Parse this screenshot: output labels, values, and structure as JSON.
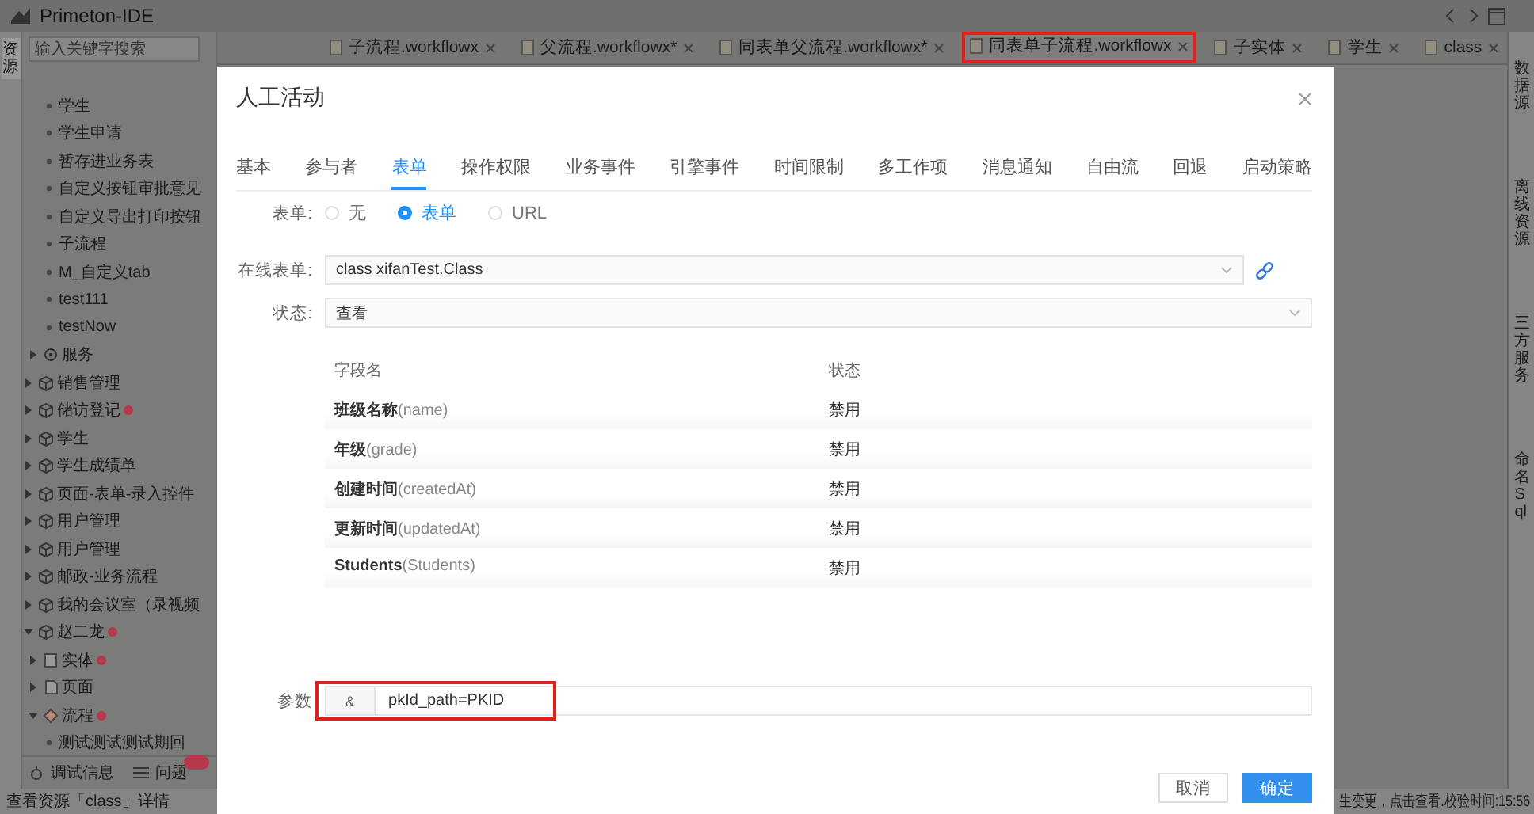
{
  "window": {
    "title": "Primeton-IDE"
  },
  "left_strip": {
    "label": "资源"
  },
  "sidebar": {
    "search": {
      "placeholder": "输入关键字搜索"
    },
    "tree": [
      {
        "kind": "offscreen",
        "children": [
          {
            "kind": "offscreen",
            "children": [
              {
                "label": "学生",
                "kind": "leaf"
              },
              {
                "label": "学生申请",
                "kind": "leaf"
              },
              {
                "label": "暂存进业务表",
                "kind": "leaf"
              },
              {
                "label": "自定义按钮审批意见",
                "kind": "leaf"
              },
              {
                "label": "自定义导出打印按钮",
                "kind": "leaf"
              },
              {
                "label": "子流程",
                "kind": "leaf"
              },
              {
                "label": "M_自定义tab",
                "kind": "leaf"
              },
              {
                "label": "test111",
                "kind": "leaf"
              },
              {
                "label": "testNow",
                "kind": "leaf"
              }
            ]
          },
          {
            "label": "服务",
            "kind": "service",
            "expanded": false,
            "alert": false
          }
        ]
      },
      {
        "label": "销售管理",
        "kind": "project",
        "expanded": false,
        "alert": false
      },
      {
        "label": "储访登记",
        "kind": "project",
        "expanded": false,
        "alert": true
      },
      {
        "label": "学生",
        "kind": "project",
        "expanded": false,
        "alert": false
      },
      {
        "label": "学生成绩单",
        "kind": "project",
        "expanded": false,
        "alert": false
      },
      {
        "label": "页面-表单-录入控件",
        "kind": "project",
        "expanded": false,
        "alert": false
      },
      {
        "label": "用户管理",
        "kind": "project",
        "expanded": false,
        "alert": false
      },
      {
        "label": "用户管理",
        "kind": "project",
        "expanded": false,
        "alert": false
      },
      {
        "label": "邮政-业务流程",
        "kind": "project",
        "expanded": false,
        "alert": false
      },
      {
        "label": "我的会议室（录视频",
        "kind": "project",
        "expanded": false,
        "alert": false
      },
      {
        "label": "赵二龙",
        "kind": "project",
        "expanded": true,
        "alert": true,
        "children": [
          {
            "label": "实体",
            "kind": "entity",
            "expanded": false,
            "alert": true
          },
          {
            "label": "页面",
            "kind": "pages",
            "expanded": false,
            "alert": false
          },
          {
            "label": "流程",
            "kind": "flow",
            "expanded": true,
            "alert": true,
            "children": [
              {
                "label": "测试测试测试期回",
                "kind": "leaf"
              }
            ]
          }
        ]
      }
    ],
    "panels": [
      {
        "label": "调试信息",
        "kind": "debug",
        "alert": false
      },
      {
        "label": "问题",
        "kind": "problems",
        "alert": true
      }
    ]
  },
  "editor_tabs": [
    {
      "label": "子流程.workflowx",
      "selected": false,
      "highlighted": false
    },
    {
      "label": "父流程.workflowx*",
      "selected": false,
      "highlighted": false
    },
    {
      "label": "同表单父流程.workflowx*",
      "selected": false,
      "highlighted": false
    },
    {
      "label": "同表单子流程.workflowx",
      "selected": true,
      "highlighted": true
    },
    {
      "label": "子实体",
      "selected": false,
      "highlighted": false
    },
    {
      "label": "学生",
      "selected": false,
      "highlighted": false
    },
    {
      "label": "class",
      "selected": false,
      "highlighted": false
    }
  ],
  "right_strip": [
    {
      "label": "数据源"
    },
    {
      "label": "离线资源"
    },
    {
      "label": "三方服务"
    },
    {
      "label": "命名Sql"
    }
  ],
  "dialog": {
    "title": "人工活动",
    "tabs": [
      {
        "label": "基本",
        "selected": false
      },
      {
        "label": "参与者",
        "selected": false
      },
      {
        "label": "表单",
        "selected": true
      },
      {
        "label": "操作权限",
        "selected": false
      },
      {
        "label": "业务事件",
        "selected": false
      },
      {
        "label": "引擎事件",
        "selected": false
      },
      {
        "label": "时间限制",
        "selected": false
      },
      {
        "label": "多工作项",
        "selected": false
      },
      {
        "label": "消息通知",
        "selected": false
      },
      {
        "label": "自由流",
        "selected": false
      },
      {
        "label": "回退",
        "selected": false
      },
      {
        "label": "启动策略",
        "selected": false
      }
    ],
    "form_type": {
      "label": "表单:",
      "options": [
        {
          "label": "无",
          "selected": false
        },
        {
          "label": "表单",
          "selected": true
        },
        {
          "label": "URL",
          "selected": false
        }
      ]
    },
    "online_form": {
      "label": "在线表单:",
      "value": "class xifanTest.Class"
    },
    "status": {
      "label": "状态:",
      "value": "查看"
    },
    "fields": {
      "columns": [
        "字段名",
        "状态"
      ],
      "rows": [
        {
          "name": "**班级名称**(name)",
          "status": "禁用"
        },
        {
          "name": "**年级**(grade)",
          "status": "禁用"
        },
        {
          "name": "**创建时间**(createdAt)",
          "status": "禁用"
        },
        {
          "name": "**更新时间**(updatedAt)",
          "status": "禁用"
        },
        {
          "name": "**Students**(Students)",
          "status": "禁用"
        }
      ]
    },
    "params": {
      "label": "参数",
      "prefix": "&",
      "value": "pkId_path=PKID",
      "highlighted": true
    },
    "buttons": [
      {
        "label": "取消",
        "kind": "default"
      },
      {
        "label": "确定",
        "kind": "primary"
      }
    ]
  },
  "status_bar": {
    "left": "查看资源「class」详情",
    "right": "生变更，点击查看.校验时间:15:56"
  }
}
